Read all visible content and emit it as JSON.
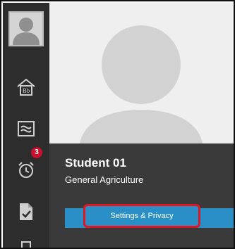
{
  "sidebar": {
    "items": [
      {
        "name": "avatar",
        "icon": "user-icon"
      },
      {
        "name": "institution",
        "icon": "blackboard-house-icon",
        "label": "Bb"
      },
      {
        "name": "activity",
        "icon": "activity-stream-icon"
      },
      {
        "name": "due-dates",
        "icon": "alarm-clock-icon",
        "badge": "3"
      },
      {
        "name": "grades",
        "icon": "grades-check-icon"
      }
    ]
  },
  "profile": {
    "name": "Student 01",
    "program": "General Agriculture",
    "settings_label": "Settings & Privacy"
  },
  "colors": {
    "sidebar_bg": "#2d2d2d",
    "accent": "#2a8fc7",
    "highlight": "#e0151f",
    "badge": "#c8102e"
  }
}
